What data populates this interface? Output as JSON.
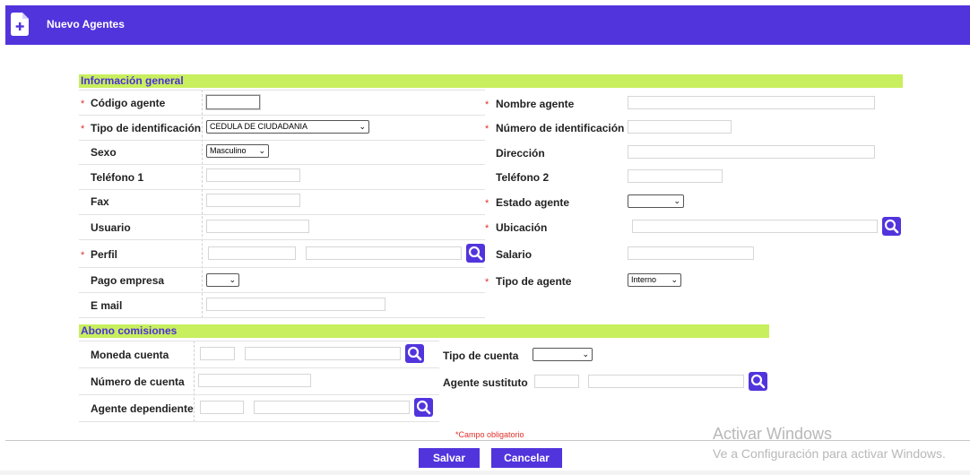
{
  "header": {
    "title": "Nuevo Agentes",
    "icon": "file-add-icon"
  },
  "sections": {
    "general": "Información general",
    "abono": "Abono comisiones"
  },
  "required_mark": "*",
  "general": {
    "codigo_agente": "Código agente",
    "tipo_identificacion": "Tipo de identificación",
    "tipo_identificacion_value": "CEDULA DE CIUDADANIA",
    "sexo": "Sexo",
    "sexo_value": "Masculino",
    "telefono1": "Teléfono 1",
    "fax": "Fax",
    "usuario": "Usuario",
    "perfil": "Perfil",
    "pago_empresa": "Pago empresa",
    "email": "E mail",
    "nombre_agente": "Nombre agente",
    "numero_identificacion": "Número de identificación",
    "direccion": "Dirección",
    "telefono2": "Teléfono 2",
    "estado_agente": "Estado agente",
    "ubicacion": "Ubicación",
    "salario": "Salario",
    "tipo_agente": "Tipo de agente",
    "tipo_agente_value": "Interno"
  },
  "abono": {
    "moneda_cuenta": "Moneda cuenta",
    "numero_cuenta": "Número de cuenta",
    "agente_dependiente": "Agente dependiente",
    "tipo_cuenta": "Tipo de cuenta",
    "agente_sustituto": "Agente sustituto"
  },
  "footer": {
    "obligatorio_mark": "*",
    "obligatorio": "Campo obligatorio",
    "salvar": "Salvar",
    "cancelar": "Cancelar"
  },
  "watermark": {
    "line1": "Activar Windows",
    "line2": "Ve a Configuración para activar Windows."
  },
  "colors": {
    "accent": "#5234dd",
    "section_bar": "#c8ef5d",
    "required": "#e0302a"
  }
}
